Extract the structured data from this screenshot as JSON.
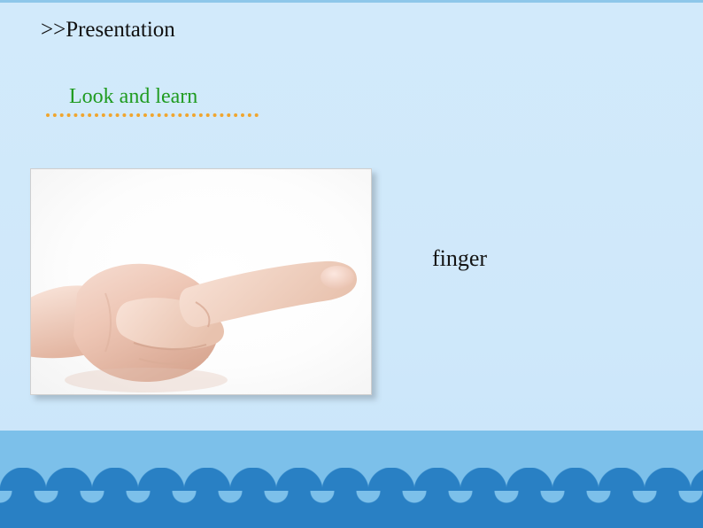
{
  "slide": {
    "heading": ">>Presentation",
    "subheading": "Look and learn",
    "vocabulary_word": "finger",
    "image_alt": "hand-pointing-photo",
    "colors": {
      "background_top": "#d2eafb",
      "background_bottom": "#c9e5f9",
      "heading_text": "#111111",
      "subheading_text": "#1f9b20",
      "dotted_rule": "#f0a52e",
      "band_light": "#7cc0ea",
      "band_dark": "#2980c4",
      "word_text": "#141414"
    }
  }
}
